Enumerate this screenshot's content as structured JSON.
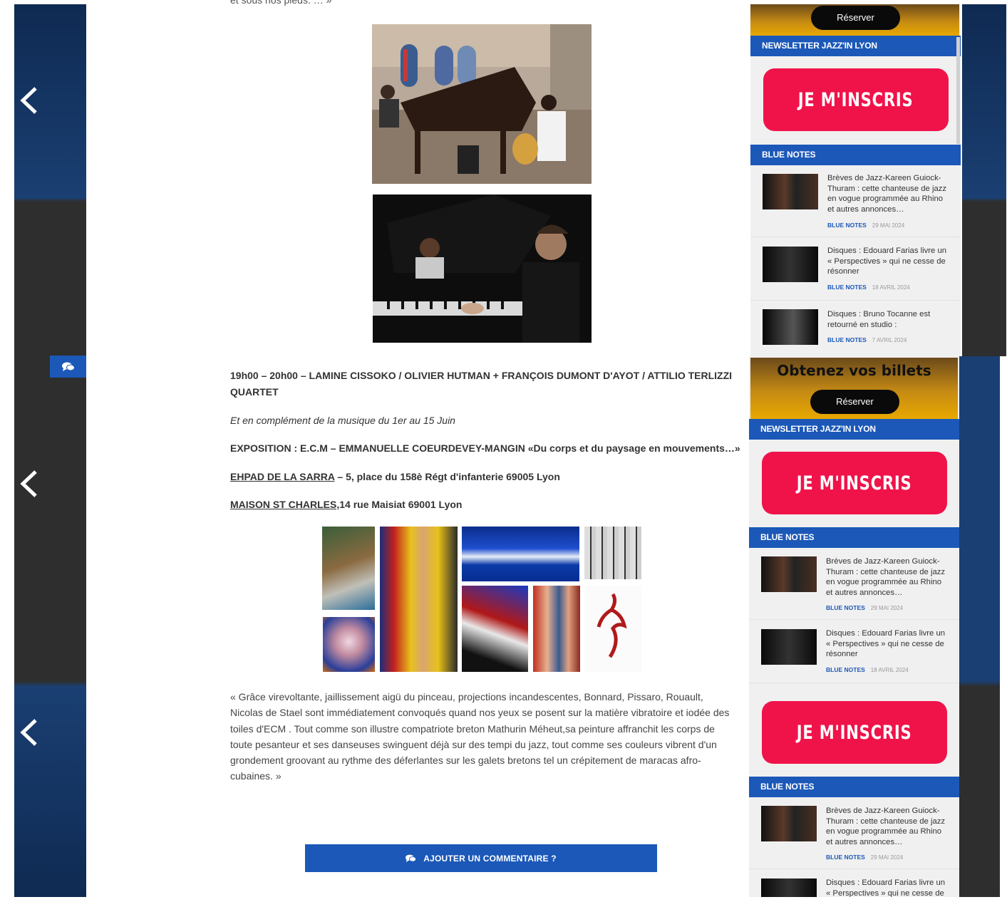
{
  "article": {
    "top_fragment": "et sous nos pieds. … »",
    "concert_line": "19h00 – 20h00 – LAMINE CISSOKO / OLIVIER HUTMAN + FRANÇOIS DUMONT D'AYOT / ATTILIO TERLIZZI QUARTET",
    "complement": "Et en complément de la musique du 1er au 15 Juin",
    "exposition": "EXPOSITION : E.C.M – EMMANUELLE COEURDEVEY-MANGIN «Du corps et du paysage en mouvements…»",
    "venue1_link": "EHPAD DE LA SARRA",
    "venue1_rest": " – 5, place du 158è Régt d'infanterie 69005 Lyon",
    "venue2_link": "MAISON ST CHARLES,",
    "venue2_rest": "14 rue Maisiat 69001 Lyon",
    "quote": "« Grâce virevoltante, jaillissement aigü du pinceau, projections incandescentes, Bonnard, Pissaro, Rouault, Nicolas de Stael sont immédiatement convoqués quand nos yeux se posent sur la matière vibratoire et iodée des toiles d'ECM . Tout comme son illustre compatriote breton Mathurin Méheut,sa peinture affranchit les corps de toute pesanteur et ses danseuses swinguent déjà sur des tempi du jazz, tout comme ses couleurs vibrent d'un grondement groovant au rythme des déferlantes sur les galets bretons tel un crépitement de maracas afro-cubaines. »",
    "comment_button": "AJOUTER UN COMMENTAIRE ?"
  },
  "sidebar": {
    "ticket_title": "Obtenez vos billets",
    "reserver": "Réserver",
    "newsletter_header": "NEWSLETTER JAZZ'IN LYON",
    "inscris": "JE M'INSCRIS",
    "blue_notes_header": "BLUE NOTES",
    "posts": [
      {
        "title": "Brèves de Jazz-Kareen Guiock-Thuram : cette chanteuse de jazz en vogue programmée au Rhino et autres annonces…",
        "category": "BLUE NOTES",
        "date": "29 MAI 2024"
      },
      {
        "title": "Disques : Edouard Farias livre un « Perspectives » qui ne cesse de résonner",
        "category": "BLUE NOTES",
        "date": "18 AVRIL 2024"
      },
      {
        "title": "Disques : Bruno Tocanne est retourné  en studio :",
        "category": "BLUE NOTES",
        "date": "7 AVRIL 2024"
      }
    ]
  },
  "icons": {
    "prev": "chevron-left-icon",
    "comment": "comments-icon"
  },
  "colors": {
    "primary_blue": "#1b58b8",
    "inscris_red": "#f0134a",
    "band_dark": "#2e2e2e"
  }
}
